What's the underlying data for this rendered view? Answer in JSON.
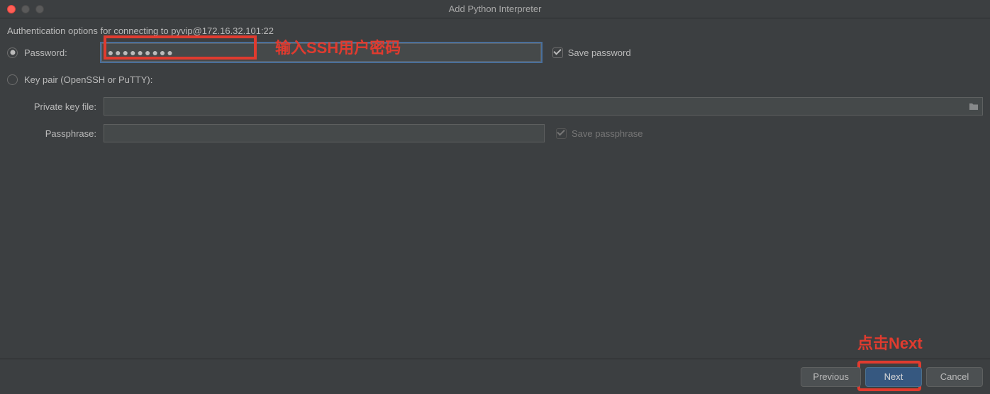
{
  "window": {
    "title": "Add Python Interpreter"
  },
  "subtitle": "Authentication options for connecting to pyvip@172.16.32.101:22",
  "options": {
    "password_label": "Password:",
    "password_value": "●●●●●●●●●",
    "save_password_label": "Save password",
    "keypair_label": "Key pair (OpenSSH or PuTTY):",
    "private_key_label": "Private key file:",
    "private_key_value": "",
    "passphrase_label": "Passphrase:",
    "passphrase_value": "",
    "save_passphrase_label": "Save passphrase"
  },
  "annotations": {
    "password_hint": "输入SSH用户密码",
    "next_hint": "点击Next"
  },
  "buttons": {
    "previous": "Previous",
    "next": "Next",
    "cancel": "Cancel"
  }
}
